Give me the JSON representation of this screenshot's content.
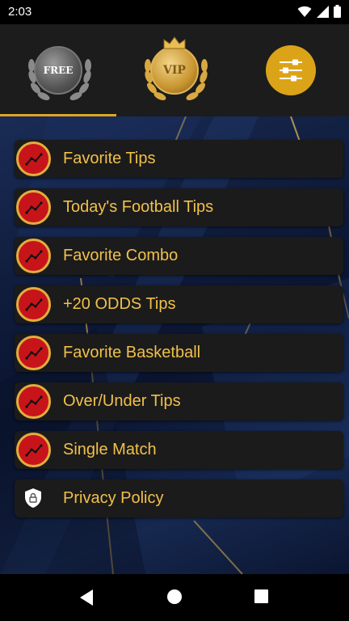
{
  "status_bar": {
    "time": "2:03",
    "icons": [
      "wifi-icon",
      "signal-icon",
      "battery-icon"
    ]
  },
  "tabs": [
    {
      "id": "free",
      "label": "FREE",
      "icon": "free-badge-icon",
      "selected": true
    },
    {
      "id": "vip",
      "label": "VIP",
      "icon": "vip-badge-icon",
      "selected": false
    },
    {
      "id": "settings",
      "label": "",
      "icon": "sliders-icon",
      "selected": false
    }
  ],
  "menu": {
    "items": [
      {
        "label": "Favorite Tips",
        "icon": "trend-chart-icon"
      },
      {
        "label": "Today's Football Tips",
        "icon": "trend-chart-icon"
      },
      {
        "label": "Favorite Combo",
        "icon": "trend-chart-icon"
      },
      {
        "label": "+20 ODDS Tips",
        "icon": "trend-chart-icon"
      },
      {
        "label": "Favorite Basketball",
        "icon": "trend-chart-icon"
      },
      {
        "label": "Over/Under Tips",
        "icon": "trend-chart-icon"
      },
      {
        "label": "Single Match",
        "icon": "trend-chart-icon"
      },
      {
        "label": "Privacy Policy",
        "icon": "shield-lock-icon"
      }
    ]
  },
  "nav_bar": {
    "buttons": [
      "back-icon",
      "home-icon",
      "recents-icon"
    ]
  },
  "colors": {
    "accent": "#e0a526",
    "label": "#f1c04a",
    "icon_red": "#c7141a",
    "item_bg": "#1b1b1b",
    "tab_bg": "#1c1c1c"
  }
}
